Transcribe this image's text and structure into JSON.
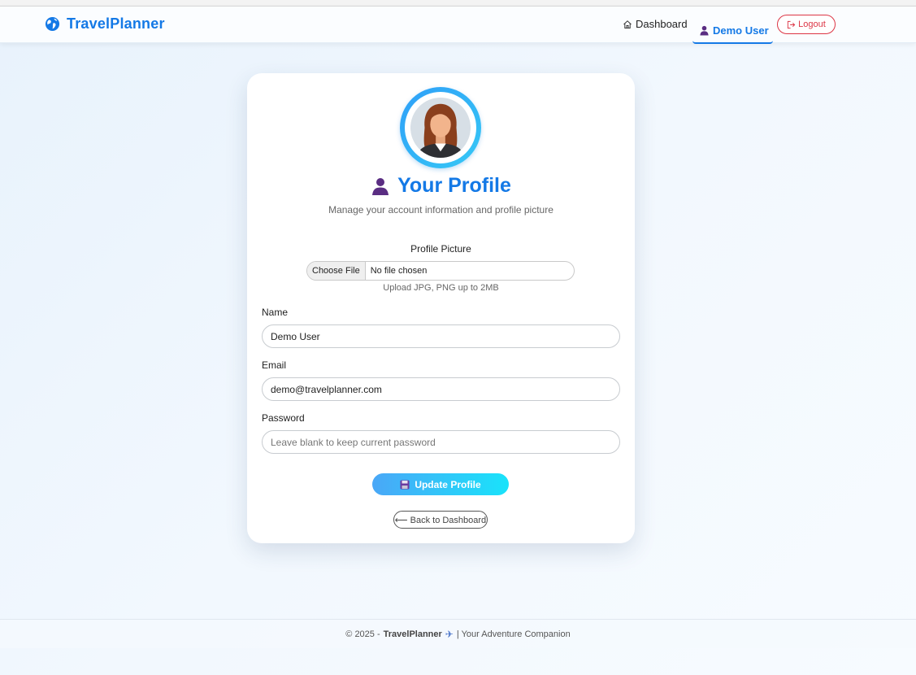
{
  "nav": {
    "brand": "TravelPlanner",
    "dashboard_label": "Dashboard",
    "user_label": "Demo User",
    "logout_label": "Logout",
    "icons": {
      "brand": "globe-icon",
      "dashboard": "home-icon",
      "user": "user-icon",
      "logout": "logout-icon"
    },
    "accent_color": "#1479e6"
  },
  "profile": {
    "title": "Your Profile",
    "subtitle": "Manage your account information and profile picture",
    "picture_label": "Profile Picture",
    "choose_file_label": "Choose File",
    "no_file_text": "No file chosen",
    "upload_hint": "Upload JPG, PNG up to 2MB",
    "name_label": "Name",
    "name_value": "Demo User",
    "email_label": "Email",
    "email_value": "demo@travelplanner.com",
    "password_label": "Password",
    "password_placeholder": "Leave blank to keep current password",
    "update_label": "Update Profile",
    "back_label": "⟵ Back to Dashboard"
  },
  "footer": {
    "prefix": "© 2025 -",
    "brand": "TravelPlanner",
    "plane": "✈",
    "suffix": "| Your Adventure Companion"
  }
}
